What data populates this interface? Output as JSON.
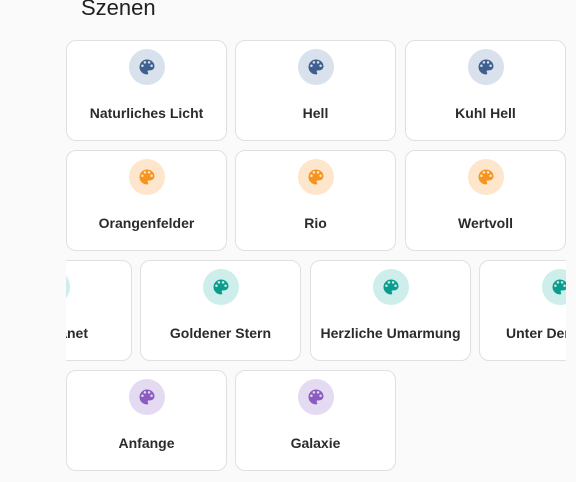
{
  "section": {
    "title": "Szenen"
  },
  "colors": {
    "blue": "#3f5f8f",
    "blue_bg": "#d8e1ec",
    "orange": "#f5941e",
    "orange_bg": "#fde6cb",
    "teal": "#0b9c8d",
    "teal_bg": "#cdeeea",
    "purple": "#8a5cc0",
    "purple_bg": "#e4daf2"
  },
  "scenes": [
    {
      "label": "Naturliches Licht",
      "icon": "palette-icon",
      "color": "blue"
    },
    {
      "label": "Hell",
      "icon": "palette-icon",
      "color": "blue"
    },
    {
      "label": "Kuhl Hell",
      "icon": "palette-icon",
      "color": "blue"
    },
    {
      "label": "Orangenfelder",
      "icon": "palette-icon",
      "color": "orange"
    },
    {
      "label": "Rio",
      "icon": "palette-icon",
      "color": "orange"
    },
    {
      "label": "Wertvoll",
      "icon": "palette-icon",
      "color": "orange"
    },
    {
      "label": "anet",
      "icon": "palette-icon",
      "color": "teal"
    },
    {
      "label": "Goldener Stern",
      "icon": "palette-icon",
      "color": "teal"
    },
    {
      "label": "Herzliche Umarmung",
      "icon": "palette-icon",
      "color": "teal"
    },
    {
      "label": "Unter Den",
      "icon": "palette-icon",
      "color": "teal"
    },
    {
      "label": "Anfange",
      "icon": "palette-icon",
      "color": "purple"
    },
    {
      "label": "Galaxie",
      "icon": "palette-icon",
      "color": "purple"
    }
  ]
}
